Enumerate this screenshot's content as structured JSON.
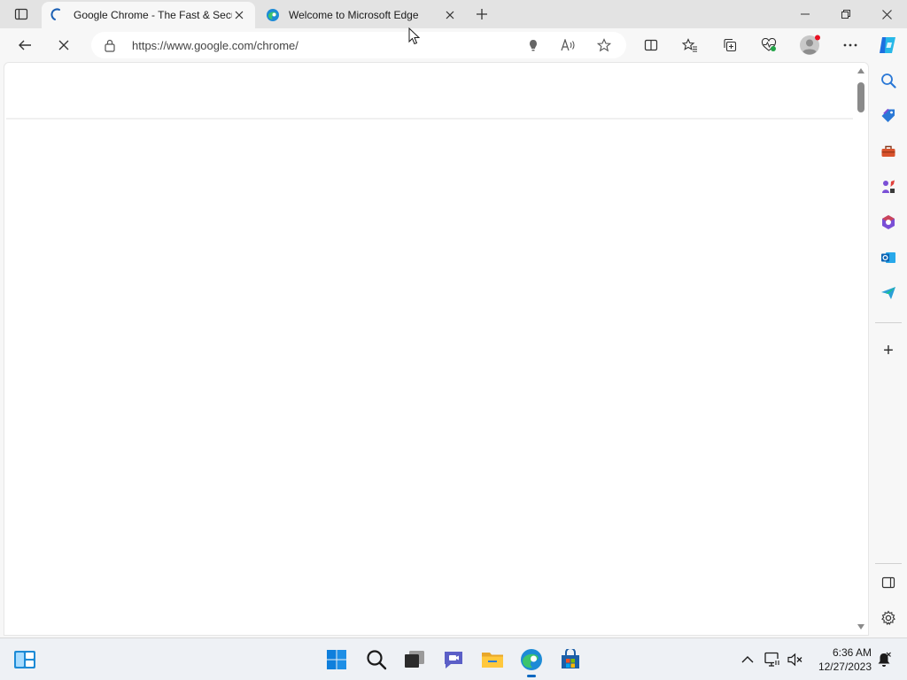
{
  "tabs": [
    {
      "title": "Google Chrome - The Fast & Secure Web Browser Built to Last",
      "state": "loading",
      "icon": "loading-spinner-icon"
    },
    {
      "title": "Welcome to Microsoft Edge",
      "state": "idle",
      "icon": "edge-logo-icon"
    }
  ],
  "address_bar": {
    "url": "https://www.google.com/chrome/"
  },
  "sidebar": {
    "items": [
      "search-icon",
      "shopping-tag-icon",
      "tools-icon",
      "games-icon",
      "microsoft-365-icon",
      "outlook-icon",
      "send-icon"
    ],
    "add_label": "+"
  },
  "taskbar": {
    "apps": [
      "start-icon",
      "search-icon",
      "task-view-icon",
      "chat-icon",
      "file-explorer-icon",
      "edge-icon",
      "store-icon"
    ],
    "time": "6:36 AM",
    "date": "12/27/2023"
  },
  "colors": {
    "accent": "#0067c0",
    "tabstrip": "#e3e3e3",
    "toolbar": "#f7f7f7"
  }
}
